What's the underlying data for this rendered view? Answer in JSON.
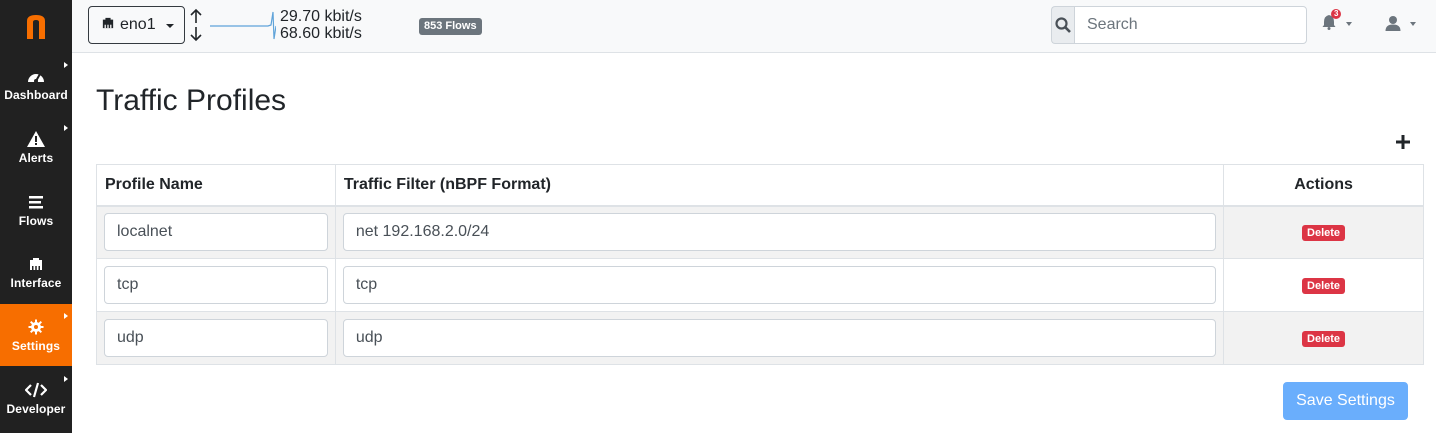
{
  "sidebar": {
    "logo_letter": "n",
    "items": [
      {
        "label": "Dashboard",
        "icon": "speedometer-icon"
      },
      {
        "label": "Alerts",
        "icon": "warning-triangle-icon"
      },
      {
        "label": "Flows",
        "icon": "stream-icon"
      },
      {
        "label": "Interface",
        "icon": "ethernet-icon"
      },
      {
        "label": "Settings",
        "icon": "gear-icon",
        "active": true
      },
      {
        "label": "Developer",
        "icon": "code-icon"
      }
    ]
  },
  "topbar": {
    "interface_name": "eno1",
    "upload_rate": "29.70 kbit/s",
    "download_rate": "68.60 kbit/s",
    "flows_badge": "853 Flows",
    "search_placeholder": "Search",
    "notification_count": "3"
  },
  "page": {
    "title": "Traffic Profiles",
    "columns": [
      "Profile Name",
      "Traffic Filter (nBPF Format)",
      "Actions"
    ],
    "rows": [
      {
        "name": "localnet",
        "filter": "net 192.168.2.0/24",
        "action": "Delete"
      },
      {
        "name": "tcp",
        "filter": "tcp",
        "action": "Delete"
      },
      {
        "name": "udp",
        "filter": "udp",
        "action": "Delete"
      }
    ],
    "save_label": "Save Settings"
  },
  "colors": {
    "accent": "#f76e00",
    "sidebar_bg": "#212121",
    "danger": "#dc3545",
    "primary_disabled": "#6aaefc"
  }
}
